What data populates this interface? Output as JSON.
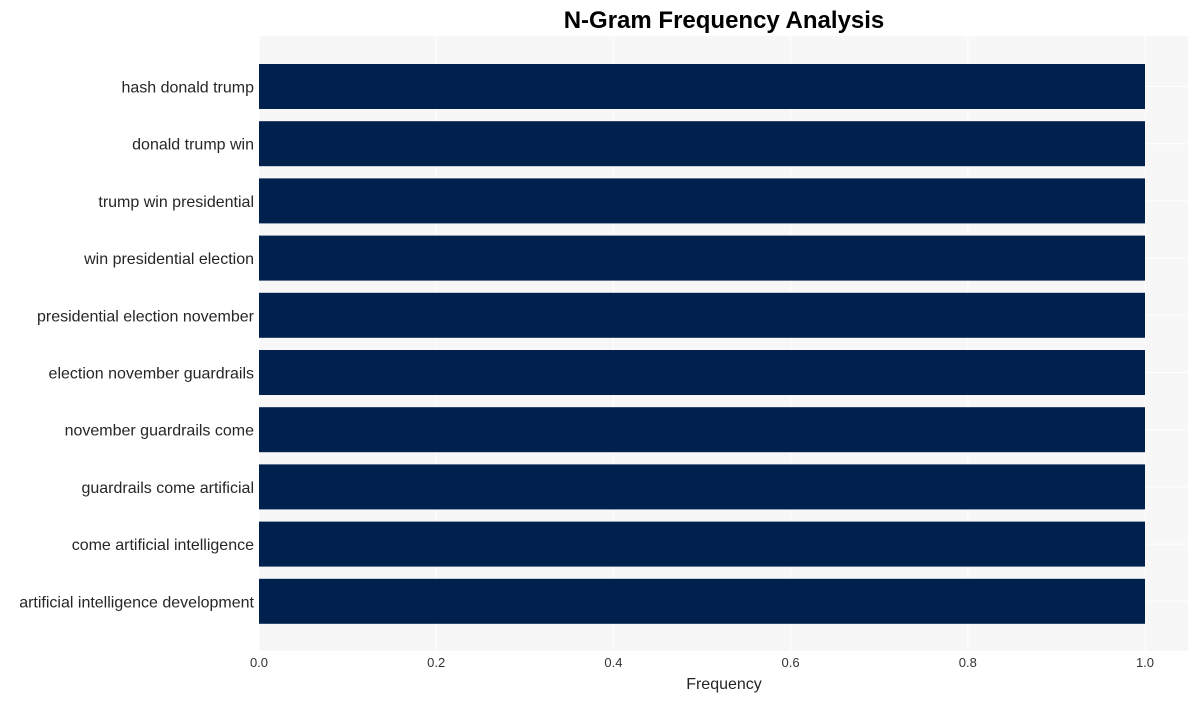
{
  "chart_data": {
    "type": "bar",
    "orientation": "horizontal",
    "title": "N-Gram Frequency Analysis",
    "xlabel": "Frequency",
    "ylabel": "",
    "categories": [
      "hash donald trump",
      "donald trump win",
      "trump win presidential",
      "win presidential election",
      "presidential election november",
      "election november guardrails",
      "november guardrails come",
      "guardrails come artificial",
      "come artificial intelligence",
      "artificial intelligence development"
    ],
    "values": [
      1,
      1,
      1,
      1,
      1,
      1,
      1,
      1,
      1,
      1
    ],
    "xlim": [
      0,
      1.05
    ],
    "xticks": [
      0.0,
      0.2,
      0.4,
      0.6,
      0.8,
      1.0
    ],
    "xtick_labels": [
      "0.0",
      "0.2",
      "0.4",
      "0.6",
      "0.8",
      "1.0"
    ],
    "grid": true,
    "legend": "none",
    "colors": {
      "bar": "#00204e",
      "plot_background": "#f7f7f7",
      "grid": "#ffffff"
    }
  }
}
